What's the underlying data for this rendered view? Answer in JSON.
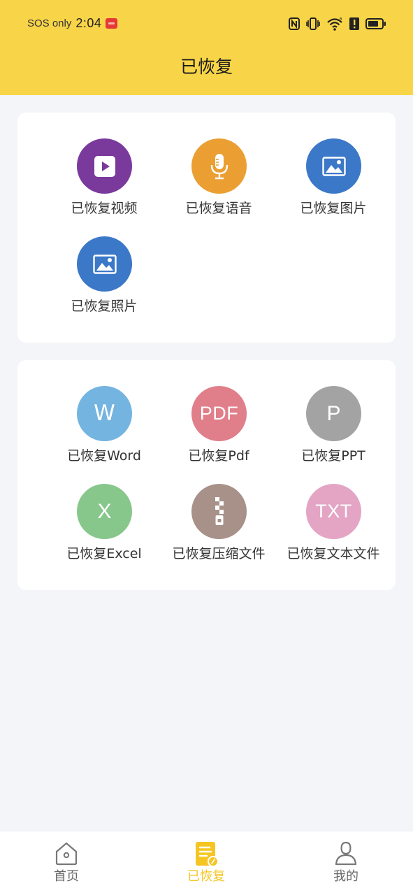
{
  "status_bar": {
    "carrier_text": "SOS only",
    "time": "2:04",
    "icons": [
      "notification-badge-icon",
      "nfc-icon",
      "vibrate-icon",
      "wifi-icon",
      "alert-icon",
      "battery-icon"
    ]
  },
  "header": {
    "title": "已恢复",
    "background_color": "#f8d548"
  },
  "media_section": {
    "items": [
      {
        "label": "已恢复视频",
        "icon": "video-play-icon",
        "color": "#7a3a9c"
      },
      {
        "label": "已恢复语音",
        "icon": "microphone-icon",
        "color": "#eb9f32"
      },
      {
        "label": "已恢复图片",
        "icon": "image-icon",
        "color": "#3c78c8"
      },
      {
        "label": "已恢复照片",
        "icon": "photo-icon",
        "color": "#3c78c8"
      }
    ]
  },
  "document_section": {
    "items": [
      {
        "label": "已恢复Word",
        "icon_text": "W",
        "icon": "word-icon",
        "color": "#74b4e0"
      },
      {
        "label": "已恢复Pdf",
        "icon_text": "PDF",
        "icon": "pdf-icon",
        "color": "#e07f8a"
      },
      {
        "label": "已恢复PPT",
        "icon_text": "P",
        "icon": "ppt-icon",
        "color": "#a3a3a3"
      },
      {
        "label": "已恢复Excel",
        "icon_text": "X",
        "icon": "excel-icon",
        "color": "#88c78c"
      },
      {
        "label": "已恢复压缩文件",
        "icon": "zip-icon",
        "color": "#a79189"
      },
      {
        "label": "已恢复文本文件",
        "icon_text": "TXT",
        "icon": "txt-icon",
        "color": "#e4a4c4"
      }
    ]
  },
  "bottom_nav": {
    "items": [
      {
        "label": "首页",
        "icon": "home-icon",
        "active": false
      },
      {
        "label": "已恢复",
        "icon": "recovered-doc-icon",
        "active": true
      },
      {
        "label": "我的",
        "icon": "profile-icon",
        "active": false
      }
    ],
    "active_color": "#f5c623",
    "inactive_color": "#666666"
  }
}
